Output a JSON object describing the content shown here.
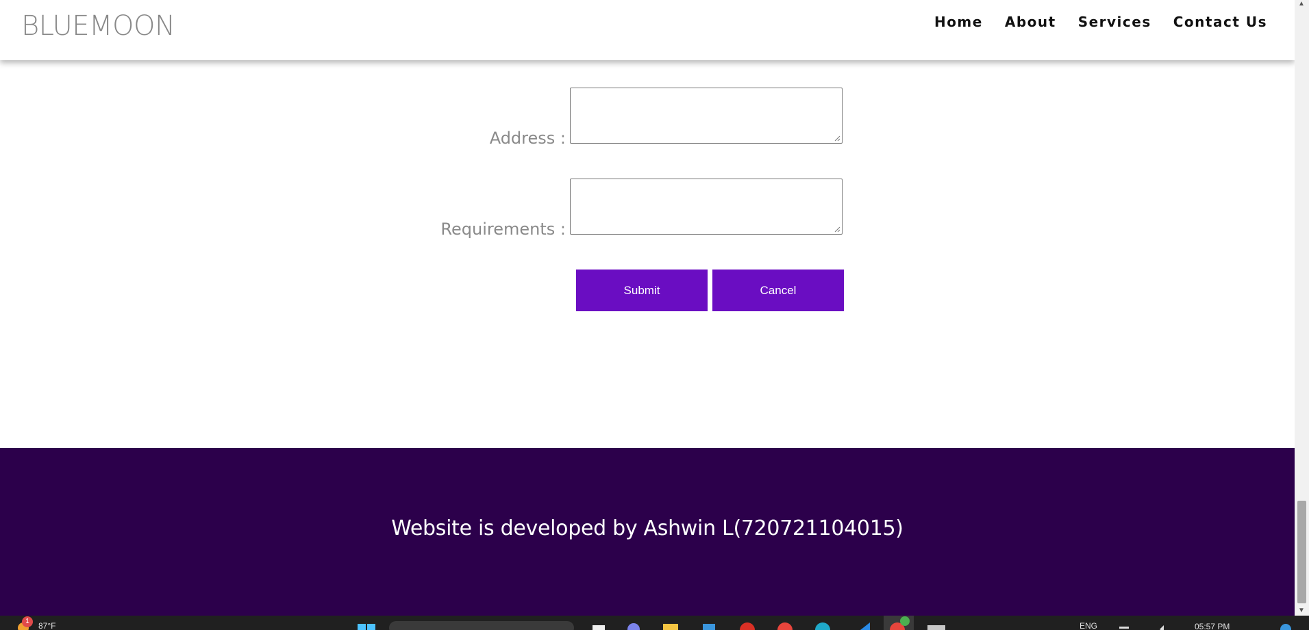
{
  "navbar": {
    "brand": "BLUEMOON",
    "links": [
      "Home",
      "About",
      "Services",
      "Contact Us"
    ]
  },
  "form": {
    "address_label": "Address :",
    "requirements_label": "Requirements :",
    "submit_label": "Submit",
    "cancel_label": "Cancel"
  },
  "footer": {
    "text": "Website is developed by Ashwin L(720721104015)"
  },
  "taskbar": {
    "weather_badge": "1",
    "temperature": "87°F",
    "language": "ENG",
    "time": "05:57 PM"
  },
  "colors": {
    "button_bg": "#6a0dc2",
    "footer_bg": "#2c004b",
    "label_gray": "#8a8a8a"
  }
}
